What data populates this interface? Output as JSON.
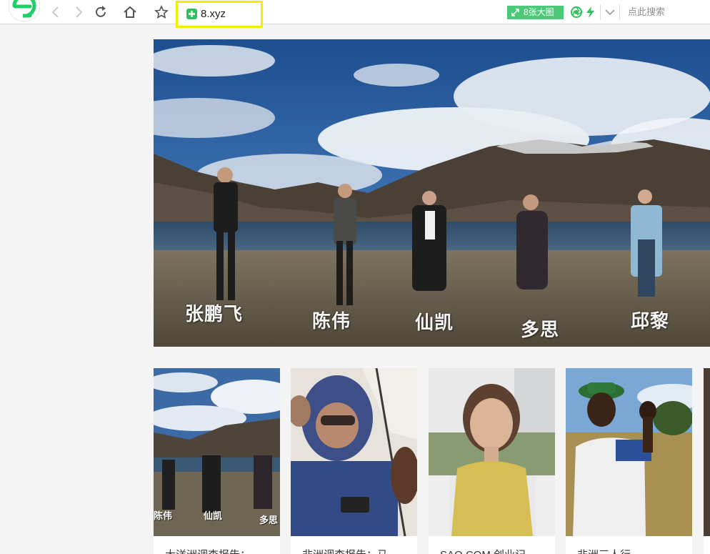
{
  "browser": {
    "address": "8.xyz",
    "big_image_button": "8张大图",
    "search_hint": "点此搜索"
  },
  "hero": {
    "names": [
      "张鹏飞",
      "陈伟",
      "仙凯",
      "多思",
      "邱黎"
    ]
  },
  "thumbnails": [
    {
      "caption": "大洋洲调查报告：",
      "tags": [
        "陈伟",
        "仙凯",
        "多思"
      ]
    },
    {
      "caption": "非洲调查报告：马"
    },
    {
      "caption": "SAO.COM 创业记"
    },
    {
      "caption": "非洲三人行"
    }
  ],
  "colors": {
    "accent_green": "#4cc978",
    "highlight_yellow": "#f2ee00"
  }
}
